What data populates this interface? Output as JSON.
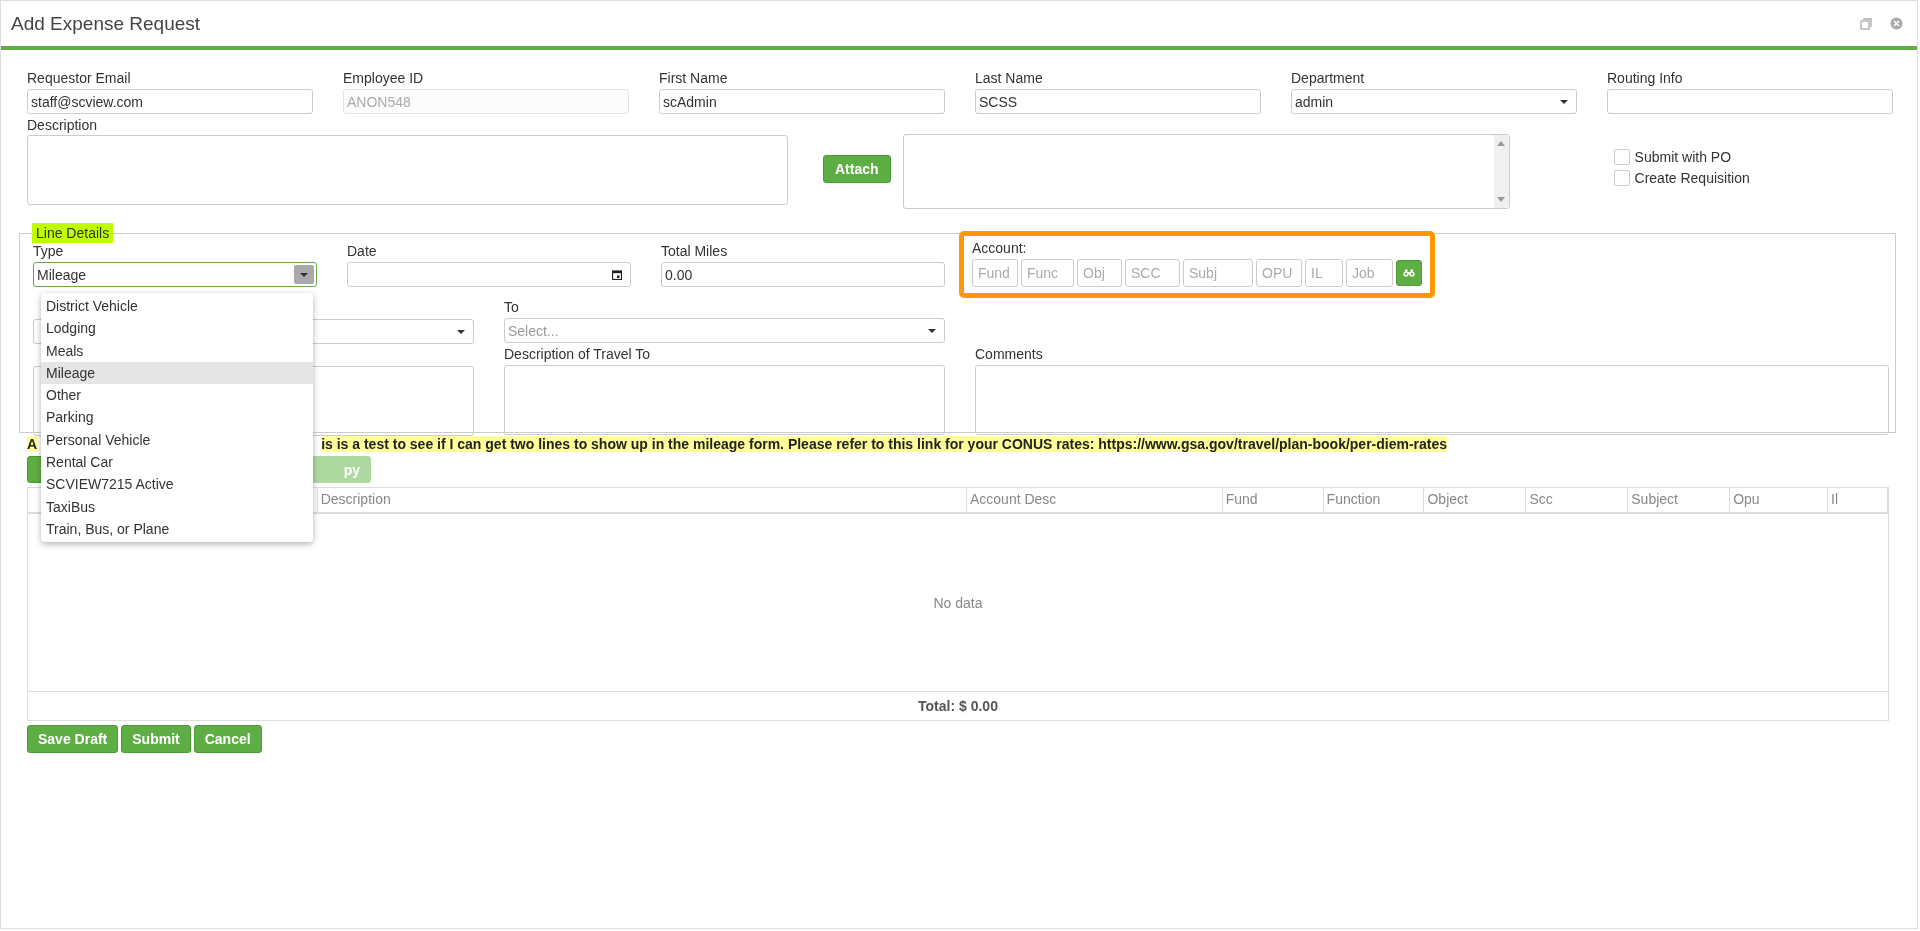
{
  "window": {
    "title": "Add Expense Request"
  },
  "header_fields": [
    {
      "label": "Requestor Email",
      "value": "staff@scview.com",
      "kind": "text",
      "disabled": false
    },
    {
      "label": "Employee ID",
      "value": "ANON548",
      "kind": "text",
      "disabled": true
    },
    {
      "label": "First Name",
      "value": "scAdmin",
      "kind": "text",
      "disabled": false
    },
    {
      "label": "Last Name",
      "value": "SCSS",
      "kind": "text",
      "disabled": false
    },
    {
      "label": "Department",
      "value": "admin",
      "kind": "select",
      "disabled": false
    },
    {
      "label": "Routing Info",
      "kind": "text",
      "disabled": false
    }
  ],
  "description": {
    "label": "Description"
  },
  "attach_button": "Attach",
  "options": [
    {
      "label": "Submit with PO",
      "checked": false
    },
    {
      "label": "Create Requisition",
      "checked": false
    }
  ],
  "line_details": {
    "legend": "Line Details",
    "type": {
      "label": "Type",
      "value": "Mileage",
      "expanded": true,
      "options": [
        {
          "label": "District Vehicle",
          "selected": false
        },
        {
          "label": "Lodging",
          "selected": false
        },
        {
          "label": "Meals",
          "selected": false
        },
        {
          "label": "Mileage",
          "selected": true
        },
        {
          "label": "Other",
          "selected": false
        },
        {
          "label": "Parking",
          "selected": false
        },
        {
          "label": "Personal Vehicle",
          "selected": false
        },
        {
          "label": "Rental Car",
          "selected": false
        },
        {
          "label": "SCVIEW7215 Active",
          "selected": false
        },
        {
          "label": "TaxiBus",
          "selected": false
        },
        {
          "label": "Train, Bus, or Plane",
          "selected": false
        }
      ]
    },
    "date": {
      "label": "Date"
    },
    "total_miles": {
      "label": "Total Miles",
      "value": "0.00"
    },
    "account": {
      "label": "Account:",
      "segments": [
        {
          "placeholder": "Fund"
        },
        {
          "placeholder": "Func"
        },
        {
          "placeholder": "Obj"
        },
        {
          "placeholder": "SCC"
        },
        {
          "placeholder": "Subj"
        },
        {
          "placeholder": "OPU"
        },
        {
          "placeholder": "IL"
        },
        {
          "placeholder": "Job"
        }
      ]
    },
    "to": {
      "label": "To",
      "placeholder": "Select..."
    },
    "travel_to": {
      "label": "Description of Travel To"
    },
    "comments": {
      "label": "Comments"
    }
  },
  "note": {
    "start": "A",
    "rest": "is is a test to see if I can get two lines to show up in the mileage form. Please refer to this link for your CONUS rates: https://www.gsa.gov/travel/plan-book/per-diem-rates"
  },
  "copy_button": {
    "label": "py",
    "disabled": true
  },
  "table": {
    "columns": [
      "Description",
      "Account Desc",
      "Fund",
      "Function",
      "Object",
      "Scc",
      "Subject",
      "Opu",
      "Il"
    ],
    "empty_text": "No data",
    "total": "Total: $ 0.00"
  },
  "actions": [
    "Save Draft",
    "Submit",
    "Cancel"
  ]
}
